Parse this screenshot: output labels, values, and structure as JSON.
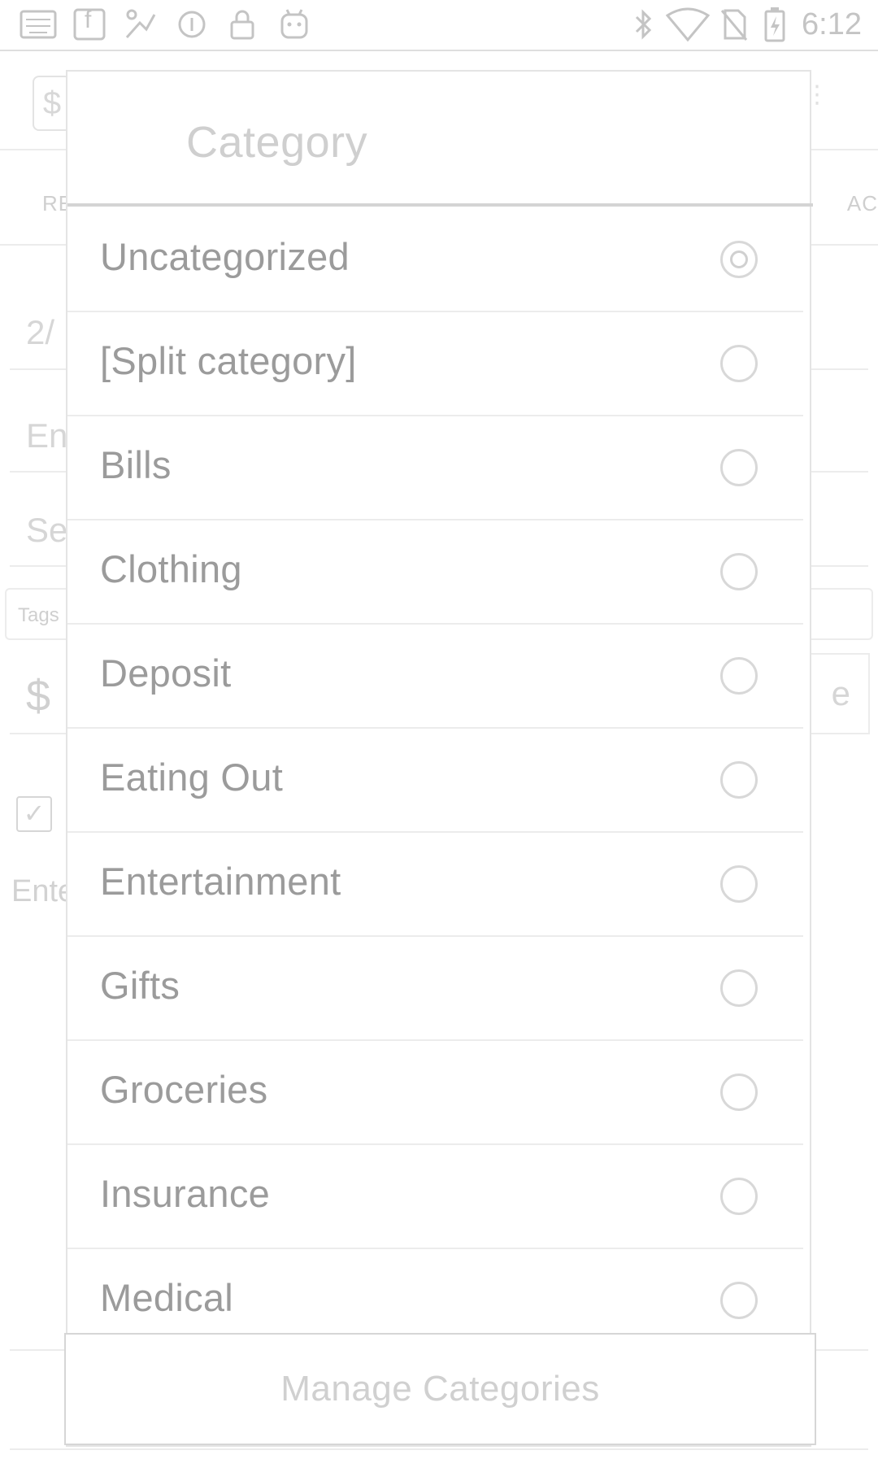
{
  "status_bar": {
    "time": "6:12",
    "left_icons": [
      "keyboard-icon",
      "facebook-icon",
      "pay-icon",
      "circle-i-icon",
      "lock-icon",
      "android-icon"
    ],
    "right_icons": [
      "bluetooth-icon",
      "wifi-icon",
      "no-sim-icon",
      "battery-charging-icon"
    ],
    "facebook_glyph": "f"
  },
  "background": {
    "logo_glyph": "$",
    "tab_left": "RE",
    "tab_right": "AC",
    "date_value": "2/",
    "entry_placeholder": "En",
    "select_placeholder": "Se",
    "tags_label": "Tags",
    "currency_symbol": "$",
    "amount_button_letter": "e",
    "check_glyph": "✓",
    "enter_text": "Ente"
  },
  "dialog": {
    "title": "Category",
    "items": [
      {
        "label": "Uncategorized",
        "selected": true
      },
      {
        "label": "[Split category]",
        "selected": false
      },
      {
        "label": "Bills",
        "selected": false
      },
      {
        "label": "Clothing",
        "selected": false
      },
      {
        "label": "Deposit",
        "selected": false
      },
      {
        "label": "Eating Out",
        "selected": false
      },
      {
        "label": "Entertainment",
        "selected": false
      },
      {
        "label": "Gifts",
        "selected": false
      },
      {
        "label": "Groceries",
        "selected": false
      },
      {
        "label": "Insurance",
        "selected": false
      },
      {
        "label": "Medical",
        "selected": false
      }
    ],
    "manage_button": "Manage Categories"
  }
}
